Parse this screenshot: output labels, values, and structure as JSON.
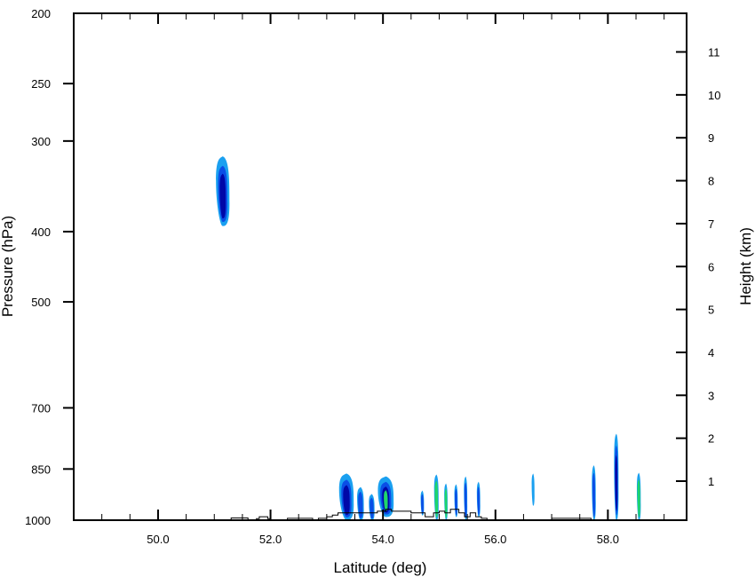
{
  "chart_data": {
    "type": "contour",
    "title": "",
    "xlabel": "Latitude (deg)",
    "ylabel": "Pressure (hPa)",
    "y2label": "Height (km)",
    "xlim": [
      48.5,
      59.4
    ],
    "ylim_pressure": [
      1000,
      200
    ],
    "ylim_height_km": [
      0.09,
      11.9
    ],
    "y_scale": "log-pressure",
    "x_ticks": [
      50.0,
      52.0,
      54.0,
      56.0,
      58.0
    ],
    "x_tick_labels": [
      "50.0",
      "52.0",
      "54.0",
      "56.0",
      "58.0"
    ],
    "y_ticks": [
      200,
      250,
      300,
      400,
      500,
      700,
      850,
      1000
    ],
    "y_tick_labels": [
      "200",
      "250",
      "300",
      "400",
      "500",
      "700",
      "850",
      "1000"
    ],
    "y2_ticks": [
      1,
      2,
      3,
      4,
      5,
      6,
      7,
      8,
      9,
      10,
      11
    ],
    "y2_tick_labels": [
      "1",
      "2",
      "3",
      "4",
      "5",
      "6",
      "7",
      "8",
      "9",
      "10",
      "11"
    ],
    "grid": false,
    "colors": {
      "light": "#1aa0f0",
      "mid": "#0a4ee6",
      "dark": "#0008a8",
      "green": "#1fd66a",
      "terrain": "#000000"
    },
    "features": [
      {
        "lat": 51.15,
        "top": 315,
        "bottom": 393,
        "half_width": 0.12,
        "levels": [
          "light",
          "mid",
          "dark"
        ]
      },
      {
        "lat": 53.35,
        "top": 862,
        "bottom": 1000,
        "half_width": 0.13,
        "levels": [
          "light",
          "mid",
          "dark"
        ]
      },
      {
        "lat": 53.6,
        "top": 900,
        "bottom": 1000,
        "half_width": 0.06,
        "levels": [
          "light",
          "mid"
        ]
      },
      {
        "lat": 53.8,
        "top": 920,
        "bottom": 1000,
        "half_width": 0.05,
        "levels": [
          "light",
          "mid"
        ]
      },
      {
        "lat": 54.05,
        "top": 870,
        "bottom": 990,
        "half_width": 0.14,
        "levels": [
          "light",
          "mid",
          "dark",
          "green"
        ]
      },
      {
        "lat": 54.7,
        "top": 910,
        "bottom": 985,
        "half_width": 0.03,
        "levels": [
          "light",
          "mid"
        ]
      },
      {
        "lat": 54.95,
        "top": 865,
        "bottom": 1000,
        "half_width": 0.04,
        "levels": [
          "light",
          "green"
        ]
      },
      {
        "lat": 55.12,
        "top": 890,
        "bottom": 1000,
        "half_width": 0.03,
        "levels": [
          "light",
          "green"
        ]
      },
      {
        "lat": 55.3,
        "top": 892,
        "bottom": 990,
        "half_width": 0.03,
        "levels": [
          "light",
          "mid"
        ]
      },
      {
        "lat": 55.47,
        "top": 870,
        "bottom": 1000,
        "half_width": 0.03,
        "levels": [
          "light",
          "mid"
        ]
      },
      {
        "lat": 55.7,
        "top": 885,
        "bottom": 990,
        "half_width": 0.03,
        "levels": [
          "light",
          "mid"
        ]
      },
      {
        "lat": 56.67,
        "top": 862,
        "bottom": 955,
        "half_width": 0.025,
        "levels": [
          "light"
        ]
      },
      {
        "lat": 57.75,
        "top": 840,
        "bottom": 1000,
        "half_width": 0.035,
        "levels": [
          "light",
          "mid"
        ]
      },
      {
        "lat": 58.15,
        "top": 760,
        "bottom": 1000,
        "half_width": 0.04,
        "levels": [
          "light",
          "mid",
          "dark"
        ]
      },
      {
        "lat": 58.55,
        "top": 860,
        "bottom": 1000,
        "half_width": 0.035,
        "levels": [
          "light",
          "green"
        ]
      }
    ],
    "terrain": [
      [
        48.5,
        1000
      ],
      [
        51.3,
        1000
      ],
      [
        51.3,
        993
      ],
      [
        51.6,
        993
      ],
      [
        51.6,
        1000
      ],
      [
        51.75,
        1000
      ],
      [
        51.75,
        995
      ],
      [
        51.8,
        995
      ],
      [
        51.8,
        989
      ],
      [
        51.95,
        989
      ],
      [
        51.95,
        995
      ],
      [
        52.0,
        995
      ],
      [
        52.0,
        1000
      ],
      [
        52.3,
        1000
      ],
      [
        52.3,
        994
      ],
      [
        52.75,
        994
      ],
      [
        52.75,
        1000
      ],
      [
        52.85,
        1000
      ],
      [
        52.85,
        994
      ],
      [
        53.0,
        994
      ],
      [
        53.0,
        989
      ],
      [
        53.1,
        989
      ],
      [
        53.1,
        984
      ],
      [
        53.2,
        984
      ],
      [
        53.2,
        977
      ],
      [
        53.9,
        977
      ],
      [
        53.9,
        972
      ],
      [
        54.05,
        972
      ],
      [
        54.05,
        966
      ],
      [
        54.15,
        966
      ],
      [
        54.15,
        972
      ],
      [
        54.5,
        972
      ],
      [
        54.5,
        977
      ],
      [
        54.75,
        977
      ],
      [
        54.75,
        989
      ],
      [
        54.9,
        989
      ],
      [
        54.9,
        977
      ],
      [
        55.0,
        977
      ],
      [
        55.0,
        972
      ],
      [
        55.1,
        972
      ],
      [
        55.1,
        977
      ],
      [
        55.2,
        977
      ],
      [
        55.2,
        966
      ],
      [
        55.35,
        966
      ],
      [
        55.35,
        977
      ],
      [
        55.45,
        977
      ],
      [
        55.45,
        989
      ],
      [
        55.55,
        989
      ],
      [
        55.55,
        977
      ],
      [
        55.65,
        977
      ],
      [
        55.65,
        989
      ],
      [
        55.75,
        989
      ],
      [
        55.75,
        994
      ],
      [
        55.85,
        994
      ],
      [
        55.85,
        1000
      ],
      [
        57.0,
        1000
      ],
      [
        57.0,
        994
      ],
      [
        57.7,
        994
      ],
      [
        57.7,
        1000
      ],
      [
        59.4,
        1000
      ]
    ]
  }
}
